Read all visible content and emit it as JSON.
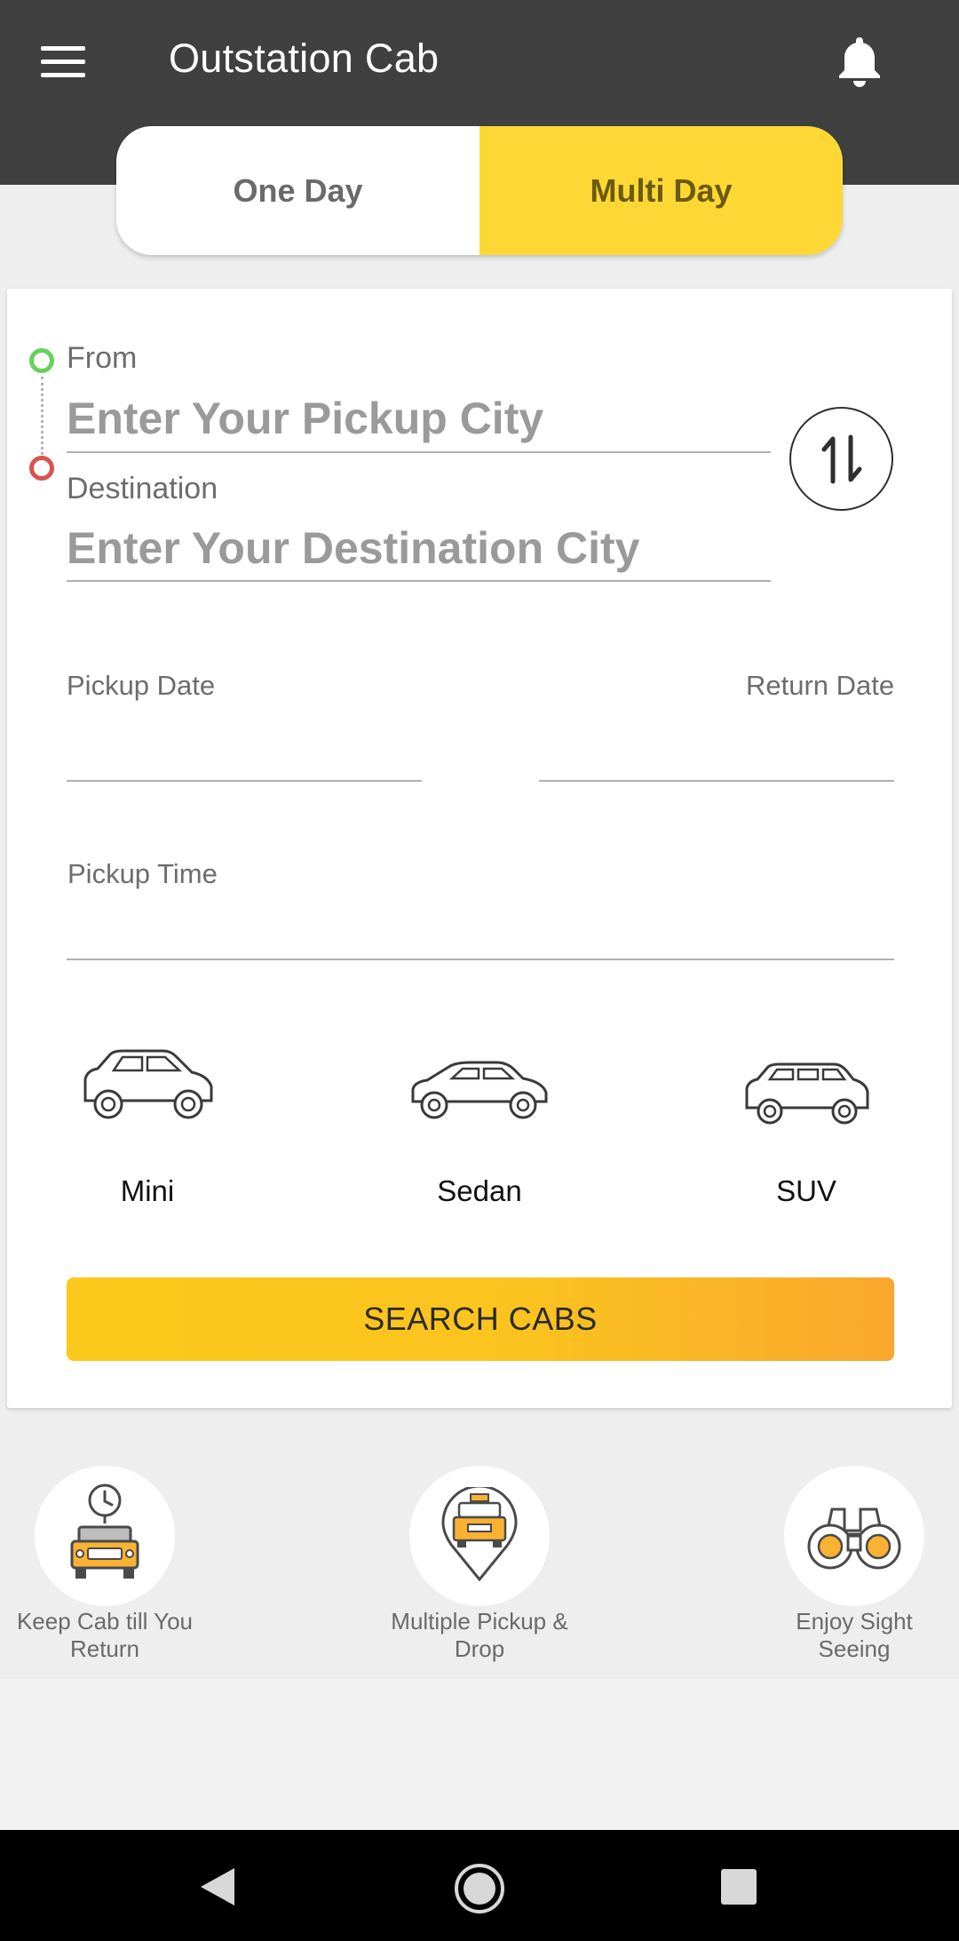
{
  "appbar": {
    "title": "Outstation Cab"
  },
  "trip_toggle": {
    "one_day": "One Day",
    "multi_day": "Multi Day",
    "selected": "Multi Day"
  },
  "from": {
    "label": "From",
    "placeholder": "Enter Your Pickup City"
  },
  "destination": {
    "label": "Destination",
    "placeholder": "Enter Your Destination City"
  },
  "pickup_date": {
    "label": "Pickup Date",
    "value": ""
  },
  "return_date": {
    "label": "Return Date",
    "value": ""
  },
  "pickup_time": {
    "label": "Pickup Time",
    "value": ""
  },
  "cab_types": [
    {
      "label": "Mini",
      "icon": "hatchback-car-icon"
    },
    {
      "label": "Sedan",
      "icon": "sedan-car-icon"
    },
    {
      "label": "SUV",
      "icon": "suv-car-icon"
    }
  ],
  "search_button": {
    "label": "SEARCH CABS"
  },
  "features": [
    {
      "label_line1": "Keep Cab till You",
      "label_line2": "Return",
      "icon": "cab-with-clock-icon"
    },
    {
      "label_line1": "Multiple Pickup &",
      "label_line2": "Drop",
      "icon": "cab-location-pin-icon"
    },
    {
      "label_line1": "Enjoy Sight",
      "label_line2": "Seeing",
      "icon": "binoculars-icon"
    }
  ],
  "colors": {
    "appbar": "#404040",
    "accent_yellow": "#fdd835",
    "from_dot": "#67d05c",
    "destination_dot": "#d9534f"
  }
}
